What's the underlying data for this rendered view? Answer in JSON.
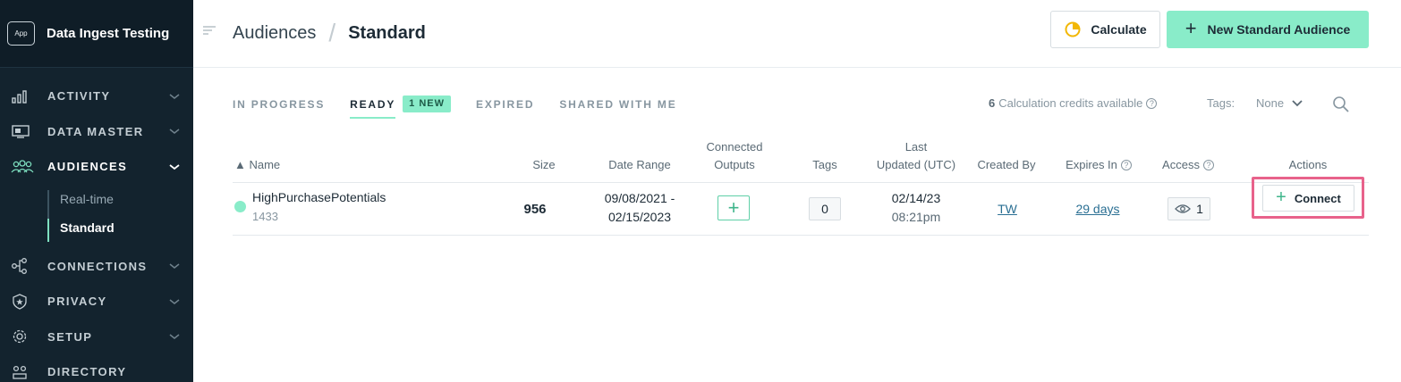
{
  "app": {
    "badge": "App",
    "name": "Data Ingest Testing"
  },
  "sidebar": {
    "items": [
      {
        "label": "ACTIVITY",
        "icon": "bar-chart-icon"
      },
      {
        "label": "DATA MASTER",
        "icon": "monitor-icon"
      },
      {
        "label": "AUDIENCES",
        "icon": "people-icon",
        "active": true
      },
      {
        "label": "CONNECTIONS",
        "icon": "flow-icon"
      },
      {
        "label": "PRIVACY",
        "icon": "shield-star-icon"
      },
      {
        "label": "SETUP",
        "icon": "gear-icon"
      },
      {
        "label": "DIRECTORY",
        "icon": "directory-icon"
      }
    ],
    "audiences_sub": [
      "Real-time",
      "Standard"
    ]
  },
  "header": {
    "breadcrumb_root": "Audiences",
    "breadcrumb_sep": "/",
    "breadcrumb_current": "Standard",
    "calculate_label": "Calculate",
    "new_audience_label": "New Standard Audience"
  },
  "tabs": {
    "in_progress": "IN PROGRESS",
    "ready": "READY",
    "new_badge": "1 NEW",
    "expired": "EXPIRED",
    "shared": "SHARED WITH ME"
  },
  "toolbar": {
    "credits_count": "6",
    "credits_text": "Calculation credits available",
    "tags_label": "Tags:",
    "tags_value": "None"
  },
  "table": {
    "headers": {
      "name": "▲ Name",
      "size": "Size",
      "date_range": "Date Range",
      "connected_1": "Connected",
      "connected_2": "Outputs",
      "tags": "Tags",
      "last_1": "Last",
      "last_2": "Updated (UTC)",
      "created_by": "Created By",
      "expires_in": "Expires In",
      "access": "Access",
      "actions": "Actions"
    },
    "row": {
      "name": "HighPurchasePotentials",
      "id": "1433",
      "size": "956",
      "date_start": "09/08/2021 -",
      "date_end": "02/15/2023",
      "connected_plus": "+",
      "tags": "0",
      "updated_date": "02/14/23",
      "updated_time": "08:21pm",
      "created_by": "TW",
      "expires_in": "29 days",
      "access_count": "1",
      "action_label": "Connect"
    }
  },
  "colors": {
    "sidebar_bg": "#13232e",
    "accent": "#89ecc9",
    "highlight": "#e8628b",
    "link": "#2a6f93"
  }
}
